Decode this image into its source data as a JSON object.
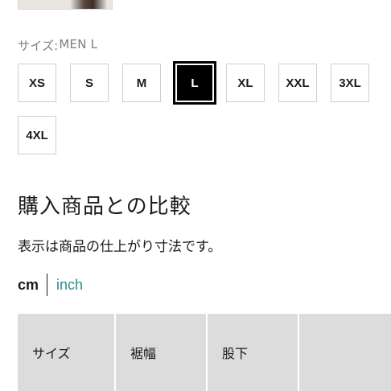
{
  "size_selector": {
    "label_prefix": "サイズ:",
    "selected_label": "MEN L",
    "options": [
      "XS",
      "S",
      "M",
      "L",
      "XL",
      "XXL",
      "3XL",
      "4XL"
    ],
    "selected": "L"
  },
  "compare_section": {
    "title": "購入商品との比較",
    "note": "表示は商品の仕上がり寸法です。"
  },
  "units": {
    "cm": "cm",
    "inch": "inch",
    "active": "cm"
  },
  "table": {
    "headers": [
      "サイズ",
      "裾幅",
      "股下",
      ""
    ]
  },
  "colors": {
    "accent_link": "#2f8b8f",
    "selected_bg": "#000000",
    "header_bg": "#dcdcdc"
  }
}
